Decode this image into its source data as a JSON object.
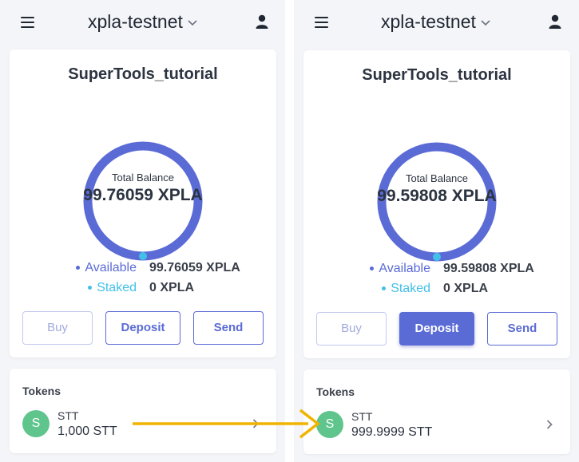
{
  "before": {
    "network": "xpla-testnet",
    "wallet_name": "SuperTools_tutorial",
    "balance_label": "Total Balance",
    "balance_value": "99.76059 XPLA",
    "available_label": "Available",
    "available_value": "99.76059 XPLA",
    "staked_label": "Staked",
    "staked_value": "0 XPLA",
    "buttons": {
      "buy": "Buy",
      "deposit": "Deposit",
      "send": "Send"
    },
    "tokens_title": "Tokens",
    "token": {
      "avatar": "S",
      "symbol": "STT",
      "amount": "1,000 STT"
    }
  },
  "after": {
    "network": "xpla-testnet",
    "wallet_name": "SuperTools_tutorial",
    "balance_label": "Total Balance",
    "balance_value": "99.59808 XPLA",
    "available_label": "Available",
    "available_value": "99.59808 XPLA",
    "staked_label": "Staked",
    "staked_value": "0 XPLA",
    "buttons": {
      "buy": "Buy",
      "deposit": "Deposit",
      "send": "Send"
    },
    "tokens_title": "Tokens",
    "token": {
      "avatar": "S",
      "symbol": "STT",
      "amount": "999.9999 STT"
    }
  },
  "colors": {
    "accent": "#5b6bd6",
    "staked": "#42c0e8",
    "token_avatar": "#5fc58d",
    "arrow": "#f0b400",
    "background": "#f4f5f8"
  },
  "icons": [
    "menu-icon",
    "chevron-down-icon",
    "user-icon",
    "chevron-right-icon",
    "arrow-right-icon"
  ]
}
